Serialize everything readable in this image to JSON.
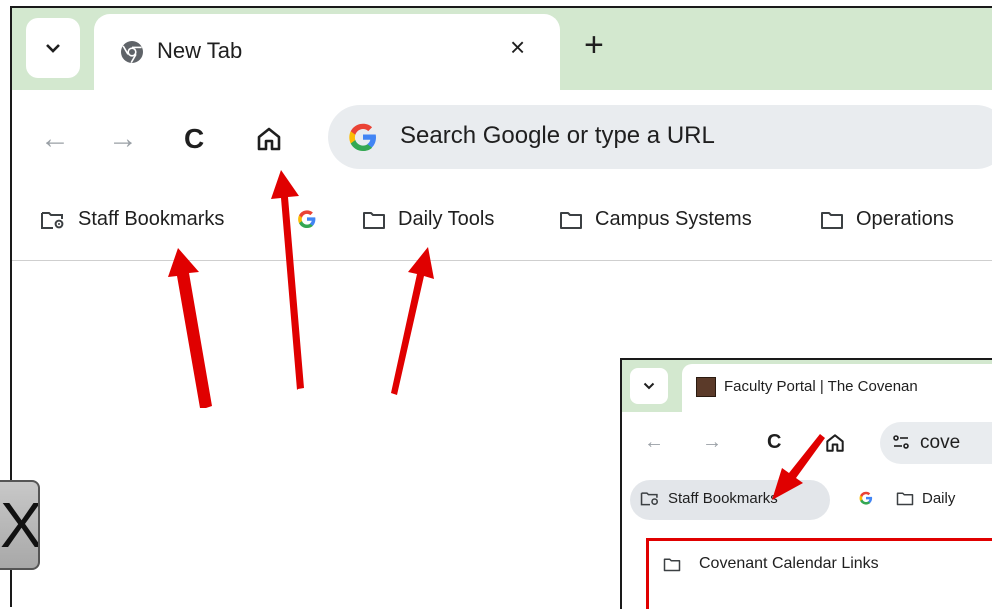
{
  "browser": {
    "tab": {
      "title": "New Tab",
      "close": "×"
    },
    "new_tab": "+",
    "nav": {
      "back": "←",
      "forward": "→",
      "reload": "C",
      "home_icon": "home-icon"
    },
    "omnibox": {
      "placeholder": "Search Google or type a URL"
    },
    "bookmarks": [
      {
        "label": "Staff Bookmarks",
        "icon": "folder-gear-icon"
      },
      {
        "label": "",
        "icon": "google-icon"
      },
      {
        "label": "Daily Tools",
        "icon": "folder-icon"
      },
      {
        "label": "Campus Systems",
        "icon": "folder-icon"
      },
      {
        "label": "Operations",
        "icon": "folder-icon"
      }
    ]
  },
  "inset": {
    "tab": {
      "title": "Faculty Portal | The Covenan"
    },
    "nav": {
      "back": "←",
      "forward": "→",
      "reload": "C"
    },
    "omnibox": {
      "text": "cove"
    },
    "bookmarks": [
      {
        "label": "Staff Bookmarks",
        "icon": "folder-gear-icon"
      },
      {
        "label": "",
        "icon": "google-icon"
      },
      {
        "label": "Daily",
        "icon": "folder-icon"
      }
    ],
    "menu": [
      {
        "label": "Covenant Calendar Links",
        "icon": "folder-icon"
      }
    ]
  },
  "side_button": {
    "label": "X"
  },
  "colors": {
    "tabbar_bg": "#d3e8cf",
    "annotation_arrow": "#e00000",
    "omnibox_bg": "#e9ecef"
  }
}
